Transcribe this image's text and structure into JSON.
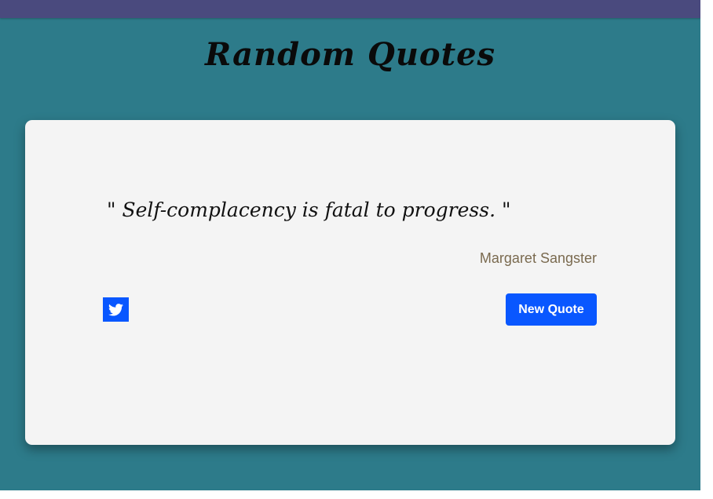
{
  "header": {
    "title": "Random Quotes"
  },
  "quote": {
    "text": "\" Self-complacency is fatal to progress. \"",
    "author": "Margaret Sangster"
  },
  "actions": {
    "tweet_icon": "twitter-icon",
    "new_quote_label": "New Quote"
  },
  "colors": {
    "topbar": "#4a4a7e",
    "background": "#2d7b8a",
    "card": "#f4f4f4",
    "accent": "#0957ff",
    "author": "#7a6a4f"
  }
}
